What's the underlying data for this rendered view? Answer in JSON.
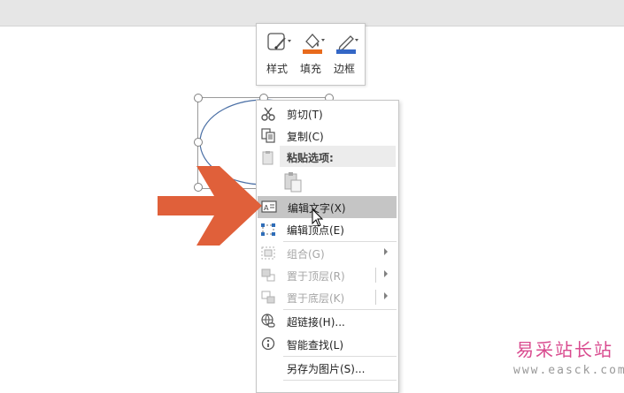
{
  "mini_toolbar": {
    "style_label": "样式",
    "fill_label": "填充",
    "border_label": "边框",
    "fill_color": "#e86a1c",
    "border_color": "#3467c6"
  },
  "paste": {
    "header": "粘贴选项:"
  },
  "menu": {
    "cut": "剪切(T)",
    "copy": "复制(C)",
    "edit_text": "编辑文字(X)",
    "edit_points": "编辑顶点(E)",
    "group": "组合(G)",
    "bring_front": "置于顶层(R)",
    "send_back": "置于底层(K)",
    "hyperlink": "超链接(H)...",
    "smart_lookup": "智能查找(L)",
    "save_as_picture": "另存为图片(S)..."
  },
  "arrow_color": "#e0603a",
  "watermark": {
    "title": "易采站长站",
    "url": "www.easck.com"
  }
}
